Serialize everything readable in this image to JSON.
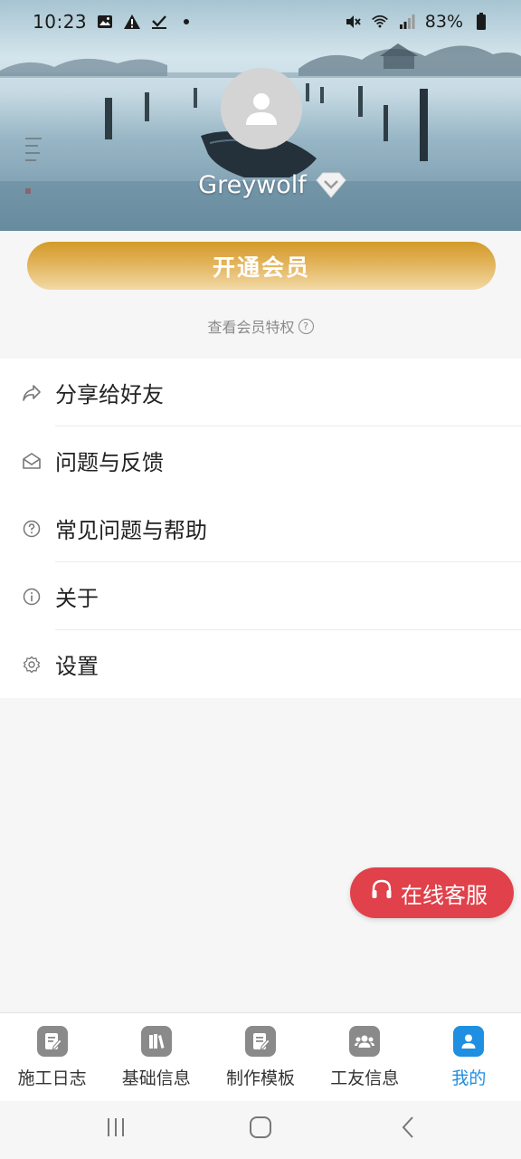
{
  "status_bar": {
    "time": "10:23",
    "battery": "83%"
  },
  "profile": {
    "username": "Greywolf"
  },
  "vip": {
    "button_label": "开通会员",
    "privileges_link": "查看会员特权",
    "help_glyph": "?"
  },
  "menu": {
    "items": [
      {
        "label": "分享给好友",
        "icon": "share-icon"
      },
      {
        "label": "问题与反馈",
        "icon": "mail-icon"
      },
      {
        "label": "常见问题与帮助",
        "icon": "help-icon"
      },
      {
        "label": "关于",
        "icon": "info-icon"
      },
      {
        "label": "设置",
        "icon": "gear-icon"
      }
    ]
  },
  "service": {
    "label": "在线客服",
    "icon": "headset-icon"
  },
  "bottom_nav": {
    "items": [
      {
        "label": "施工日志",
        "icon": "log-icon"
      },
      {
        "label": "基础信息",
        "icon": "books-icon"
      },
      {
        "label": "制作模板",
        "icon": "template-icon"
      },
      {
        "label": "工友信息",
        "icon": "group-icon"
      },
      {
        "label": "我的",
        "icon": "user-icon"
      }
    ],
    "active_index": 4
  },
  "colors": {
    "accent_blue": "#1e8fe1",
    "vip_gold": "#d39a2a",
    "service_red": "#e0414a",
    "inactive_icon": "#8a8a8a"
  }
}
